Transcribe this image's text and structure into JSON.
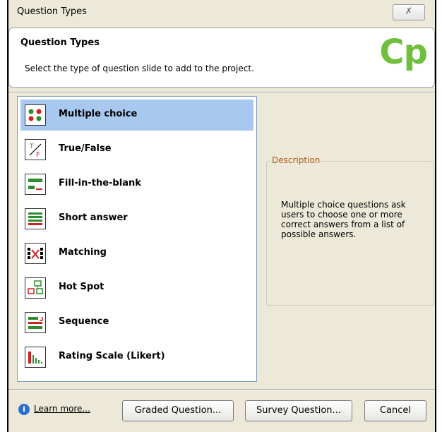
{
  "window": {
    "title": "Question Types",
    "close_glyph": "✗"
  },
  "header": {
    "title": "Question Types",
    "subtitle": "Select the type of question slide to add to the project.",
    "logo_text": "Cp"
  },
  "question_types": [
    {
      "label": "Multiple choice",
      "icon": "multiple-choice-icon",
      "selected": true
    },
    {
      "label": "True/False",
      "icon": "true-false-icon"
    },
    {
      "label": "Fill-in-the-blank",
      "icon": "fill-blank-icon"
    },
    {
      "label": "Short answer",
      "icon": "short-answer-icon"
    },
    {
      "label": "Matching",
      "icon": "matching-icon"
    },
    {
      "label": "Hot Spot",
      "icon": "hot-spot-icon"
    },
    {
      "label": "Sequence",
      "icon": "sequence-icon"
    },
    {
      "label": "Rating Scale (Likert)",
      "icon": "rating-scale-icon"
    }
  ],
  "description": {
    "legend": "Description",
    "text": "Multiple choice questions ask users to choose one or more correct answers from a list of possible answers."
  },
  "footer": {
    "learn_more": "Learn more...",
    "graded_button": "Graded Question...",
    "survey_button": "Survey Question...",
    "cancel_button": "Cancel"
  },
  "colors": {
    "accent_green": "#6fbf3c",
    "selection": "#a8c8f0",
    "legend": "#b05a1a"
  }
}
